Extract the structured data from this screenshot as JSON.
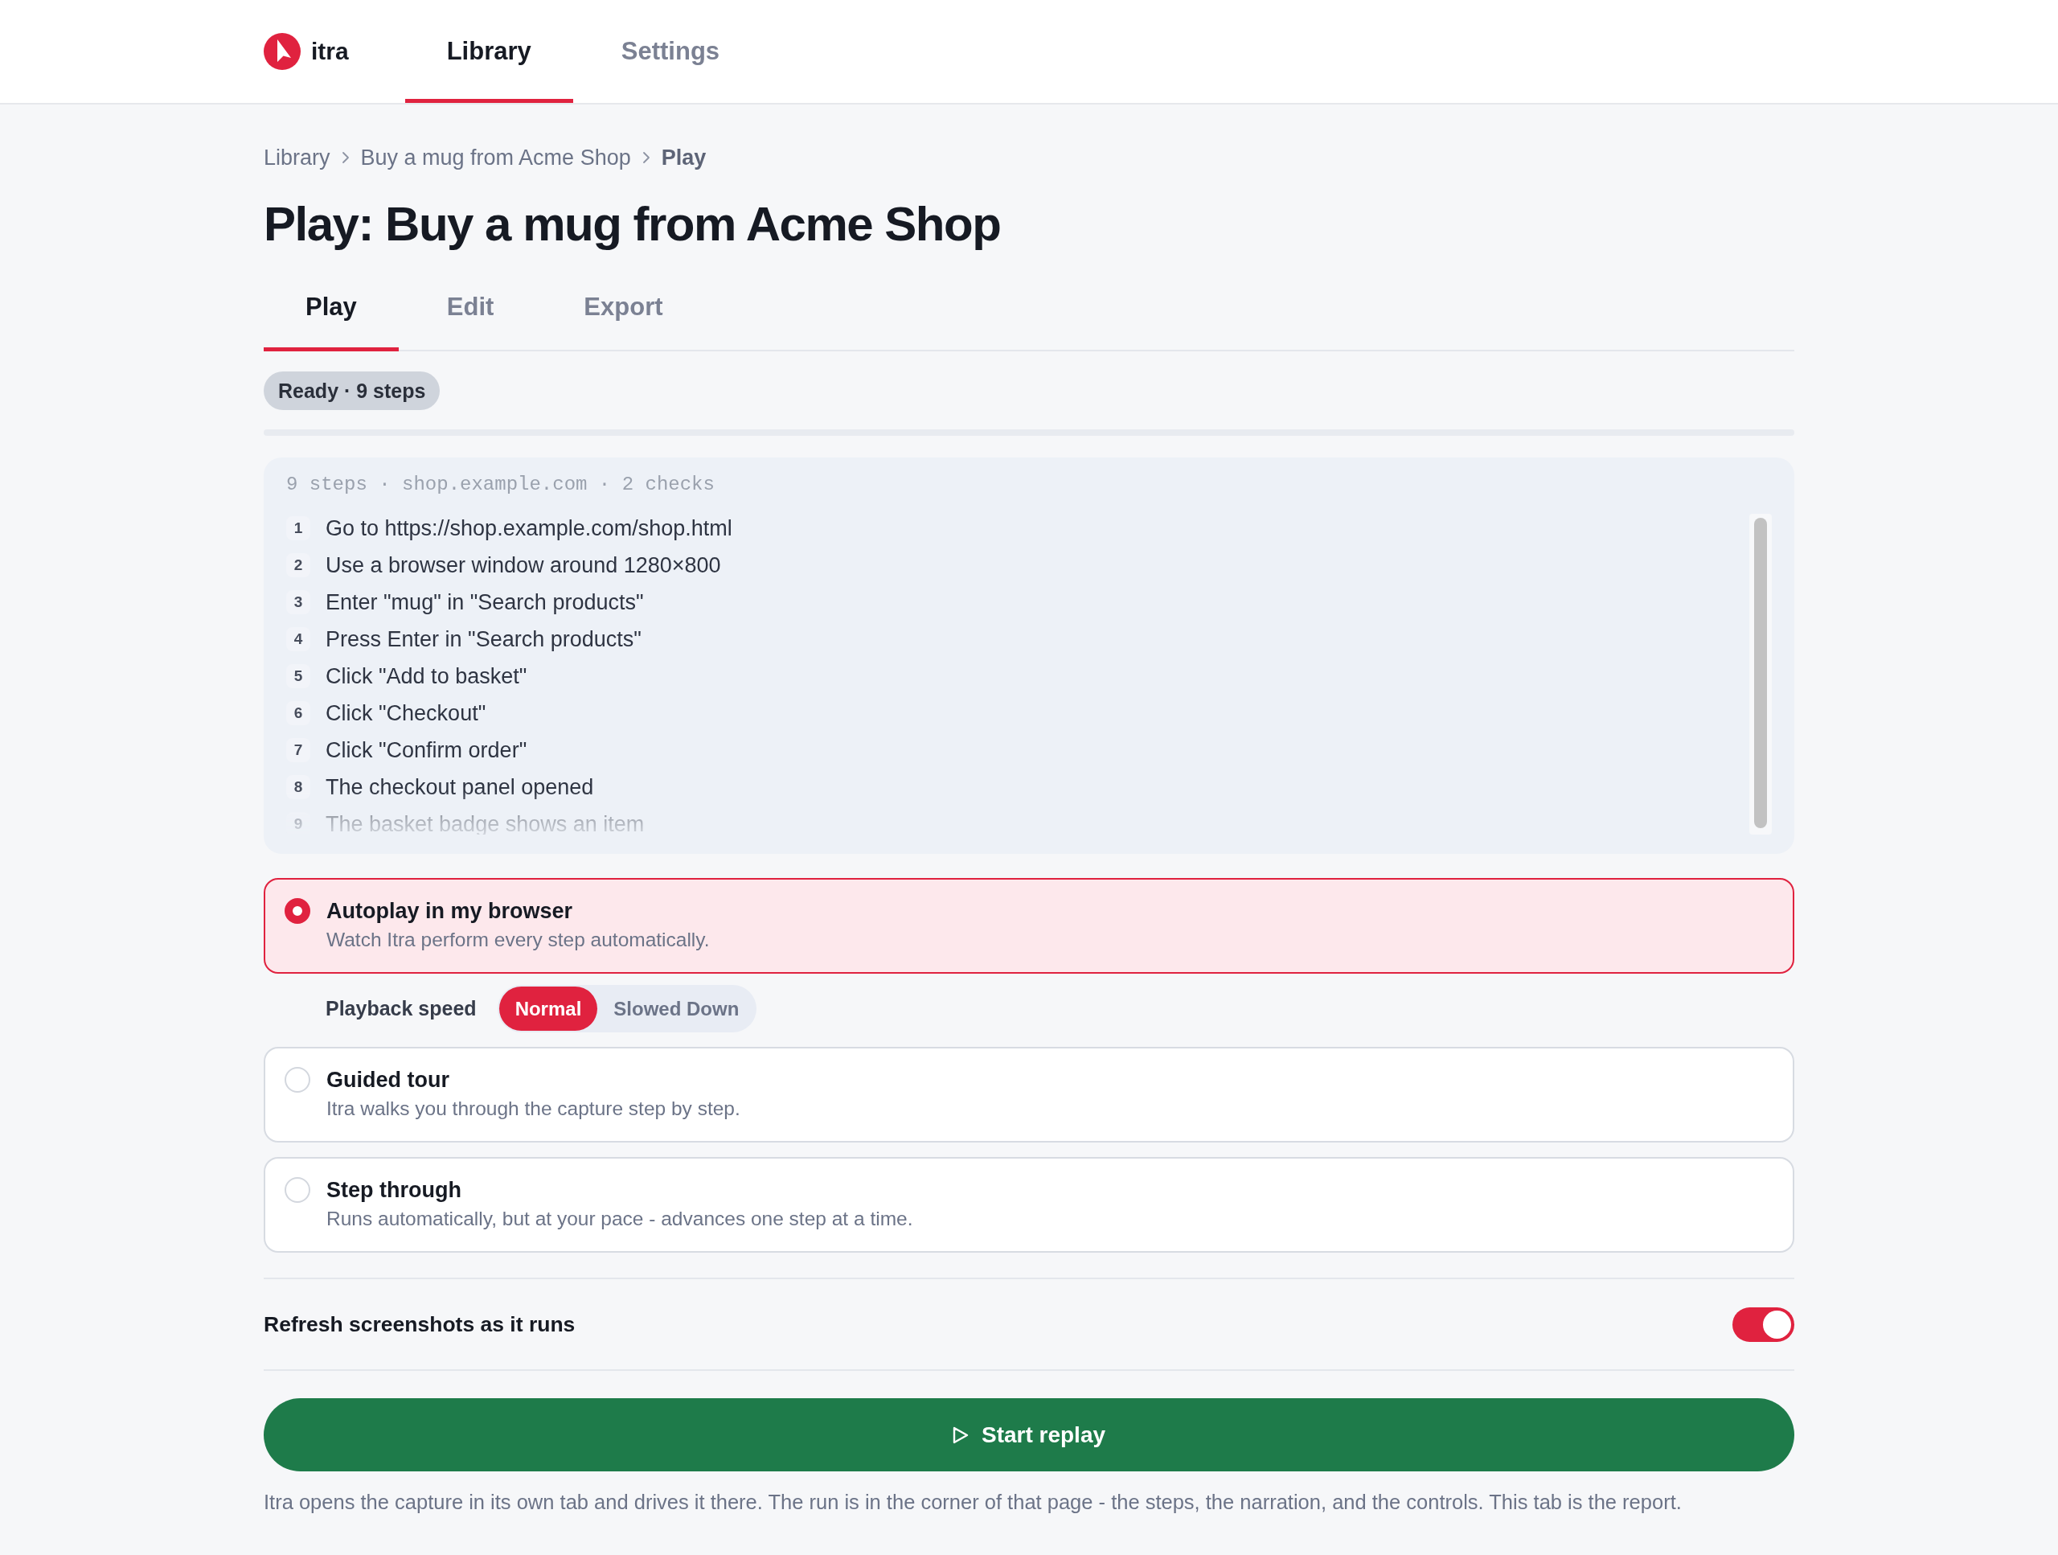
{
  "app": {
    "name": "itra"
  },
  "nav": [
    {
      "label": "Library",
      "selected": true
    },
    {
      "label": "Settings",
      "selected": false
    }
  ],
  "breadcrumb": [
    {
      "label": "Library",
      "current": false
    },
    {
      "label": "Buy a mug from Acme Shop",
      "current": false
    },
    {
      "label": "Play",
      "current": true
    }
  ],
  "title": "Play: Buy a mug from Acme Shop",
  "tabs": [
    {
      "label": "Play",
      "selected": true
    },
    {
      "label": "Edit",
      "selected": false
    },
    {
      "label": "Export",
      "selected": false
    }
  ],
  "status_badge": "Ready · 9 steps",
  "progress": {
    "level": 0
  },
  "steps_panel": {
    "summary": "9 steps · shop.example.com · 2 checks",
    "steps": [
      {
        "number": "1",
        "text": "Go to https://shop.example.com/shop.html"
      },
      {
        "number": "2",
        "text": "Use a browser window around 1280×800"
      },
      {
        "number": "3",
        "text": "Enter \"mug\" in \"Search products\""
      },
      {
        "number": "4",
        "text": "Press Enter in \"Search products\""
      },
      {
        "number": "5",
        "text": "Click \"Add to basket\""
      },
      {
        "number": "6",
        "text": "Click \"Checkout\""
      },
      {
        "number": "7",
        "text": "Click \"Confirm order\""
      },
      {
        "number": "8",
        "text": "The checkout panel opened"
      },
      {
        "number": "9",
        "text": "The basket badge shows an item"
      }
    ]
  },
  "modes": [
    {
      "title": "Autoplay in my browser",
      "description": "Watch Itra perform every step automatically.",
      "selected": true,
      "playback_speed": {
        "label": "Playback speed",
        "options": [
          {
            "label": "Normal",
            "selected": true
          },
          {
            "label": "Slowed Down",
            "selected": false
          }
        ]
      }
    },
    {
      "title": "Guided tour",
      "description": "Itra walks you through the capture step by step.",
      "selected": false
    },
    {
      "title": "Step through",
      "description": "Runs automatically, but at your pace - advances one step at a time.",
      "selected": false
    }
  ],
  "refresh_screenshots": {
    "label": "Refresh screenshots as it runs",
    "on": true
  },
  "start_button": {
    "label": "Start replay"
  },
  "note": "Itra opens the capture in its own tab and drives it there. The run is in the corner of that page - the steps, the narration, and the controls. This tab is the report."
}
